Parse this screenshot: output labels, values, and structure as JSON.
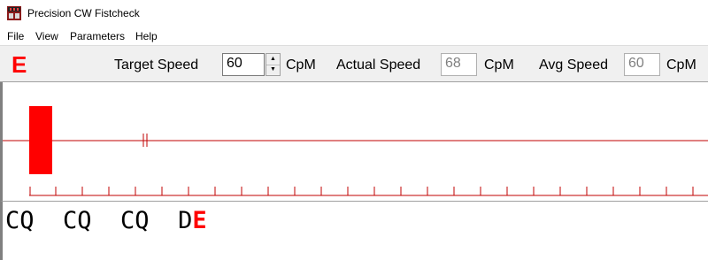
{
  "window": {
    "title": "Precision CW Fistcheck"
  },
  "menu": [
    {
      "label": "File"
    },
    {
      "label": "View"
    },
    {
      "label": "Parameters"
    },
    {
      "label": "Help"
    }
  ],
  "toolbar": {
    "current_char": "E",
    "target_speed_label": "Target Speed",
    "target_speed_value": "60",
    "target_speed_unit": "CpM",
    "actual_speed_label": "Actual Speed",
    "actual_speed_value": "68",
    "actual_speed_unit": "CpM",
    "avg_speed_label": "Avg Speed",
    "avg_speed_value": "60",
    "avg_speed_unit": "CpM"
  },
  "decoded": {
    "text": "CQ  CQ  CQ  D",
    "last_char": "E"
  },
  "colors": {
    "accent": "#ff0000",
    "plot_line": "#c00000"
  }
}
